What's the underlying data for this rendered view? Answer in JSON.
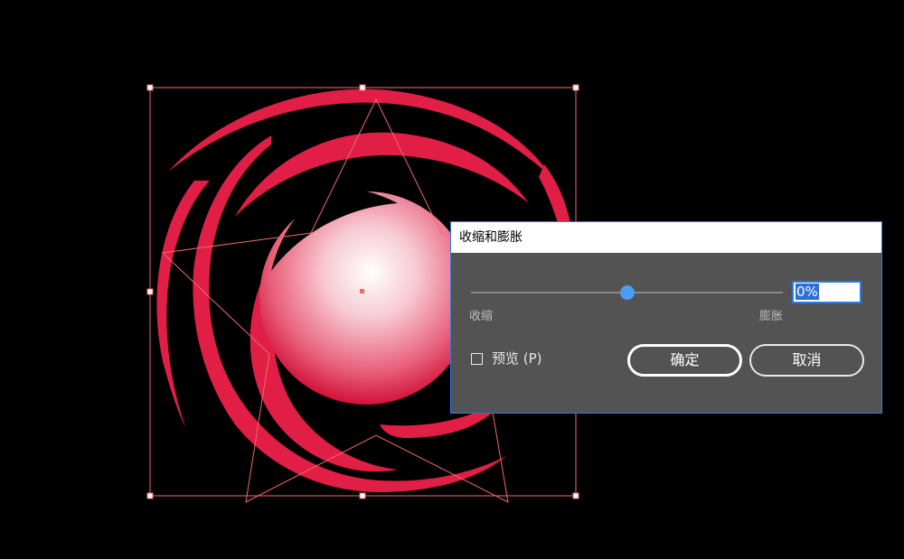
{
  "dialog": {
    "title": "收缩和膨胀",
    "slider": {
      "left_label": "收缩",
      "right_label": "膨胀",
      "value_text": "0%",
      "value": 0,
      "min": -100,
      "max": 100
    },
    "preview": {
      "label": "预览 (P)",
      "checked": false
    },
    "ok_label": "确定",
    "cancel_label": "取消"
  },
  "colors": {
    "canvas_background": "#000000",
    "artwork_red": "#e01e46",
    "selection_outline": "#f06a6a",
    "dialog_background": "#535353",
    "accent_blue": "#4a9df0"
  }
}
